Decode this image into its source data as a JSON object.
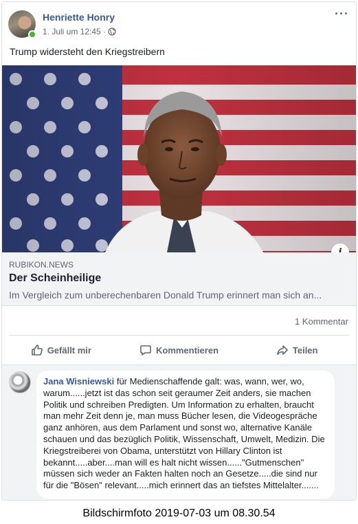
{
  "post": {
    "author": "Henriette Honry",
    "timestamp": "1. Juli um 12:45 ·",
    "privacy_icon": "globe-icon",
    "more_icon": "···",
    "text": "Trump widersteht den Kriegstreibern"
  },
  "link_preview": {
    "domain": "RUBIKON.NEWS",
    "title": "Der Scheinheilige",
    "description": "Im Vergleich zum unberechenbaren Donald Trump erinnert man sich an...",
    "info_icon": "i"
  },
  "stats": {
    "comments": "1 Kommentar"
  },
  "actions": {
    "like": "Gefällt mir",
    "comment": "Kommentieren",
    "share": "Teilen"
  },
  "comment": {
    "author": "Jana Wisniewski",
    "text": " für Medienschaffende galt: was, wann, wer, wo, warum......jetzt ist das schon seit geraumer Zeit anders, sie machen Politik und schreiben Predigten. Um Information zu erhalten, braucht man mehr Zeit denn je, man muss Bücher lesen, die Videogespräche ganz anhören, aus dem Parlament und sonst wo, alternative Kanäle schauen und das bezüglich Politik, Wissenschaft, Umwelt, Medizin. Die Kriegstreiberei von Obama, unterstützt von Hillary Clinton ist bekannt.....aber....man will es halt nicht wissen......\"Gutmenschen\" müssen sich weder an Fakten halten noch an Gesetze.....die sind nur für die \"Bösen\" relevant.....mich erinnert das an tiefstes Mittelalter......."
  },
  "caption": "Bildschirmfoto 2019-07-03 um 08.30.54",
  "colors": {
    "link": "#385898",
    "muted": "#606770",
    "online": "#42b72a"
  }
}
